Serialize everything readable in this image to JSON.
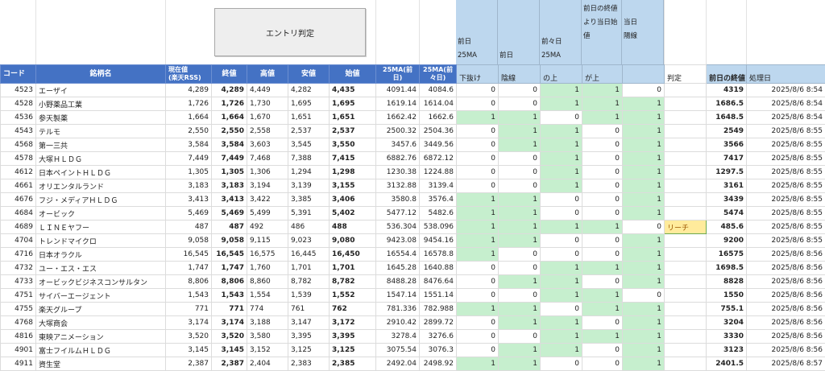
{
  "button": {
    "label": "エントリ判定"
  },
  "top_headers": [
    {
      "lines": [
        "",
        "",
        "前日",
        "25MA",
        "下抜け"
      ]
    },
    {
      "lines": [
        "",
        "",
        "",
        "前日",
        "陰線"
      ]
    },
    {
      "lines": [
        "",
        "",
        "前々日",
        "25MA",
        "の上"
      ]
    },
    {
      "lines": [
        "前日の終値",
        "より当日始",
        "値",
        "",
        "が上"
      ]
    },
    {
      "lines": [
        "",
        "",
        "当日",
        "陽線",
        ""
      ]
    }
  ],
  "headers": {
    "code": "コード",
    "name": "銘柄名",
    "current": "現在値\n(楽天RSS)",
    "close": "終値",
    "high": "高値",
    "low": "安値",
    "open": "始値",
    "ma_prev": "25MA(前\n日)",
    "ma_prev2": "25MA(前\n々日)",
    "judge": "判定",
    "prev_close": "前日の終値",
    "processed": "処理日"
  },
  "rows": [
    {
      "code": "4523",
      "name": "エーザイ",
      "current": "4,289",
      "close": "4,289",
      "high": "4,449",
      "low": "4,282",
      "open": "4,435",
      "ma1": "4091.44",
      "ma2": "4084.6",
      "f": [
        "0",
        "0",
        "1",
        "1",
        "0"
      ],
      "judge": "",
      "prev": "4319",
      "date": "2025/8/6 8:54"
    },
    {
      "code": "4528",
      "name": "小野薬品工業",
      "current": "1,726",
      "close": "1,726",
      "high": "1,730",
      "low": "1,695",
      "open": "1,695",
      "ma1": "1619.14",
      "ma2": "1614.04",
      "f": [
        "0",
        "0",
        "1",
        "1",
        "1"
      ],
      "judge": "",
      "prev": "1686.5",
      "date": "2025/8/6 8:54"
    },
    {
      "code": "4536",
      "name": "参天製薬",
      "current": "1,664",
      "close": "1,664",
      "high": "1,670",
      "low": "1,651",
      "open": "1,651",
      "ma1": "1662.42",
      "ma2": "1662.6",
      "f": [
        "1",
        "1",
        "0",
        "1",
        "1"
      ],
      "judge": "",
      "prev": "1648.5",
      "date": "2025/8/6 8:54"
    },
    {
      "code": "4543",
      "name": "テルモ",
      "current": "2,550",
      "close": "2,550",
      "high": "2,558",
      "low": "2,537",
      "open": "2,537",
      "ma1": "2500.32",
      "ma2": "2504.36",
      "f": [
        "0",
        "1",
        "1",
        "0",
        "1"
      ],
      "judge": "",
      "prev": "2549",
      "date": "2025/8/6 8:55"
    },
    {
      "code": "4568",
      "name": "第一三共",
      "current": "3,584",
      "close": "3,584",
      "high": "3,603",
      "low": "3,545",
      "open": "3,550",
      "ma1": "3457.6",
      "ma2": "3449.56",
      "f": [
        "0",
        "1",
        "1",
        "0",
        "1"
      ],
      "judge": "",
      "prev": "3566",
      "date": "2025/8/6 8:55"
    },
    {
      "code": "4578",
      "name": "大塚ＨＬＤＧ",
      "current": "7,449",
      "close": "7,449",
      "high": "7,468",
      "low": "7,388",
      "open": "7,415",
      "ma1": "6882.76",
      "ma2": "6872.12",
      "f": [
        "0",
        "0",
        "1",
        "0",
        "1"
      ],
      "judge": "",
      "prev": "7417",
      "date": "2025/8/6 8:55"
    },
    {
      "code": "4612",
      "name": "日本ペイントＨＬＤＧ",
      "current": "1,305",
      "close": "1,305",
      "high": "1,306",
      "low": "1,294",
      "open": "1,298",
      "ma1": "1230.38",
      "ma2": "1224.88",
      "f": [
        "0",
        "0",
        "1",
        "0",
        "1"
      ],
      "judge": "",
      "prev": "1297.5",
      "date": "2025/8/6 8:55"
    },
    {
      "code": "4661",
      "name": "オリエンタルランド",
      "current": "3,183",
      "close": "3,183",
      "high": "3,194",
      "low": "3,139",
      "open": "3,155",
      "ma1": "3132.88",
      "ma2": "3139.4",
      "f": [
        "0",
        "0",
        "1",
        "0",
        "1"
      ],
      "judge": "",
      "prev": "3161",
      "date": "2025/8/6 8:55"
    },
    {
      "code": "4676",
      "name": "フジ・メディアＨＬＤＧ",
      "current": "3,413",
      "close": "3,413",
      "high": "3,422",
      "low": "3,385",
      "open": "3,406",
      "ma1": "3580.8",
      "ma2": "3576.4",
      "f": [
        "1",
        "1",
        "0",
        "0",
        "1"
      ],
      "judge": "",
      "prev": "3439",
      "date": "2025/8/6 8:55"
    },
    {
      "code": "4684",
      "name": "オービック",
      "current": "5,469",
      "close": "5,469",
      "high": "5,499",
      "low": "5,391",
      "open": "5,402",
      "ma1": "5477.12",
      "ma2": "5482.6",
      "f": [
        "1",
        "1",
        "0",
        "0",
        "1"
      ],
      "judge": "",
      "prev": "5474",
      "date": "2025/8/6 8:55"
    },
    {
      "code": "4689",
      "name": "ＬＩＮＥヤフー",
      "current": "487",
      "close": "487",
      "high": "492",
      "low": "486",
      "open": "488",
      "ma1": "536.304",
      "ma2": "538.096",
      "f": [
        "1",
        "1",
        "1",
        "1",
        "0"
      ],
      "judge": "リーチ",
      "prev": "485.6",
      "date": "2025/8/6 8:55"
    },
    {
      "code": "4704",
      "name": "トレンドマイクロ",
      "current": "9,058",
      "close": "9,058",
      "high": "9,115",
      "low": "9,023",
      "open": "9,080",
      "ma1": "9423.08",
      "ma2": "9454.16",
      "f": [
        "1",
        "1",
        "0",
        "0",
        "1"
      ],
      "judge": "",
      "prev": "9200",
      "date": "2025/8/6 8:55"
    },
    {
      "code": "4716",
      "name": "日本オラクル",
      "current": "16,545",
      "close": "16,545",
      "high": "16,575",
      "low": "16,445",
      "open": "16,450",
      "ma1": "16554.4",
      "ma2": "16578.8",
      "f": [
        "1",
        "0",
        "0",
        "0",
        "1"
      ],
      "judge": "",
      "prev": "16575",
      "date": "2025/8/6 8:56"
    },
    {
      "code": "4732",
      "name": "ユー・エス・エス",
      "current": "1,747",
      "close": "1,747",
      "high": "1,760",
      "low": "1,701",
      "open": "1,701",
      "ma1": "1645.28",
      "ma2": "1640.88",
      "f": [
        "0",
        "0",
        "1",
        "1",
        "1"
      ],
      "judge": "",
      "prev": "1698.5",
      "date": "2025/8/6 8:56"
    },
    {
      "code": "4733",
      "name": "オービックビジネスコンサルタン",
      "current": "8,806",
      "close": "8,806",
      "high": "8,860",
      "low": "8,782",
      "open": "8,782",
      "ma1": "8488.28",
      "ma2": "8476.64",
      "f": [
        "0",
        "1",
        "1",
        "0",
        "1"
      ],
      "judge": "",
      "prev": "8828",
      "date": "2025/8/6 8:56"
    },
    {
      "code": "4751",
      "name": "サイバーエージェント",
      "current": "1,543",
      "close": "1,543",
      "high": "1,554",
      "low": "1,539",
      "open": "1,552",
      "ma1": "1547.14",
      "ma2": "1551.14",
      "f": [
        "0",
        "0",
        "1",
        "1",
        "0"
      ],
      "judge": "",
      "prev": "1550",
      "date": "2025/8/6 8:56"
    },
    {
      "code": "4755",
      "name": "楽天グループ",
      "current": "771",
      "close": "771",
      "high": "774",
      "low": "761",
      "open": "762",
      "ma1": "781.336",
      "ma2": "782.988",
      "f": [
        "1",
        "1",
        "0",
        "1",
        "1"
      ],
      "judge": "",
      "prev": "755.1",
      "date": "2025/8/6 8:56"
    },
    {
      "code": "4768",
      "name": "大塚商会",
      "current": "3,174",
      "close": "3,174",
      "high": "3,188",
      "low": "3,147",
      "open": "3,172",
      "ma1": "2910.42",
      "ma2": "2899.72",
      "f": [
        "0",
        "1",
        "1",
        "0",
        "1"
      ],
      "judge": "",
      "prev": "3204",
      "date": "2025/8/6 8:56"
    },
    {
      "code": "4816",
      "name": "東映アニメーション",
      "current": "3,520",
      "close": "3,520",
      "high": "3,580",
      "low": "3,395",
      "open": "3,395",
      "ma1": "3278.4",
      "ma2": "3276.6",
      "f": [
        "0",
        "0",
        "1",
        "1",
        "1"
      ],
      "judge": "",
      "prev": "3330",
      "date": "2025/8/6 8:56"
    },
    {
      "code": "4901",
      "name": "富士フイルムＨＬＤＧ",
      "current": "3,145",
      "close": "3,145",
      "high": "3,152",
      "low": "3,125",
      "open": "3,125",
      "ma1": "3075.54",
      "ma2": "3076.3",
      "f": [
        "0",
        "1",
        "1",
        "0",
        "1"
      ],
      "judge": "",
      "prev": "3123",
      "date": "2025/8/6 8:56"
    },
    {
      "code": "4911",
      "name": "資生堂",
      "current": "2,387",
      "close": "2,387",
      "high": "2,404",
      "low": "2,383",
      "open": "2,385",
      "ma1": "2492.04",
      "ma2": "2498.92",
      "f": [
        "1",
        "1",
        "0",
        "0",
        "1"
      ],
      "judge": "",
      "prev": "2401.5",
      "date": "2025/8/6 8:57"
    }
  ]
}
